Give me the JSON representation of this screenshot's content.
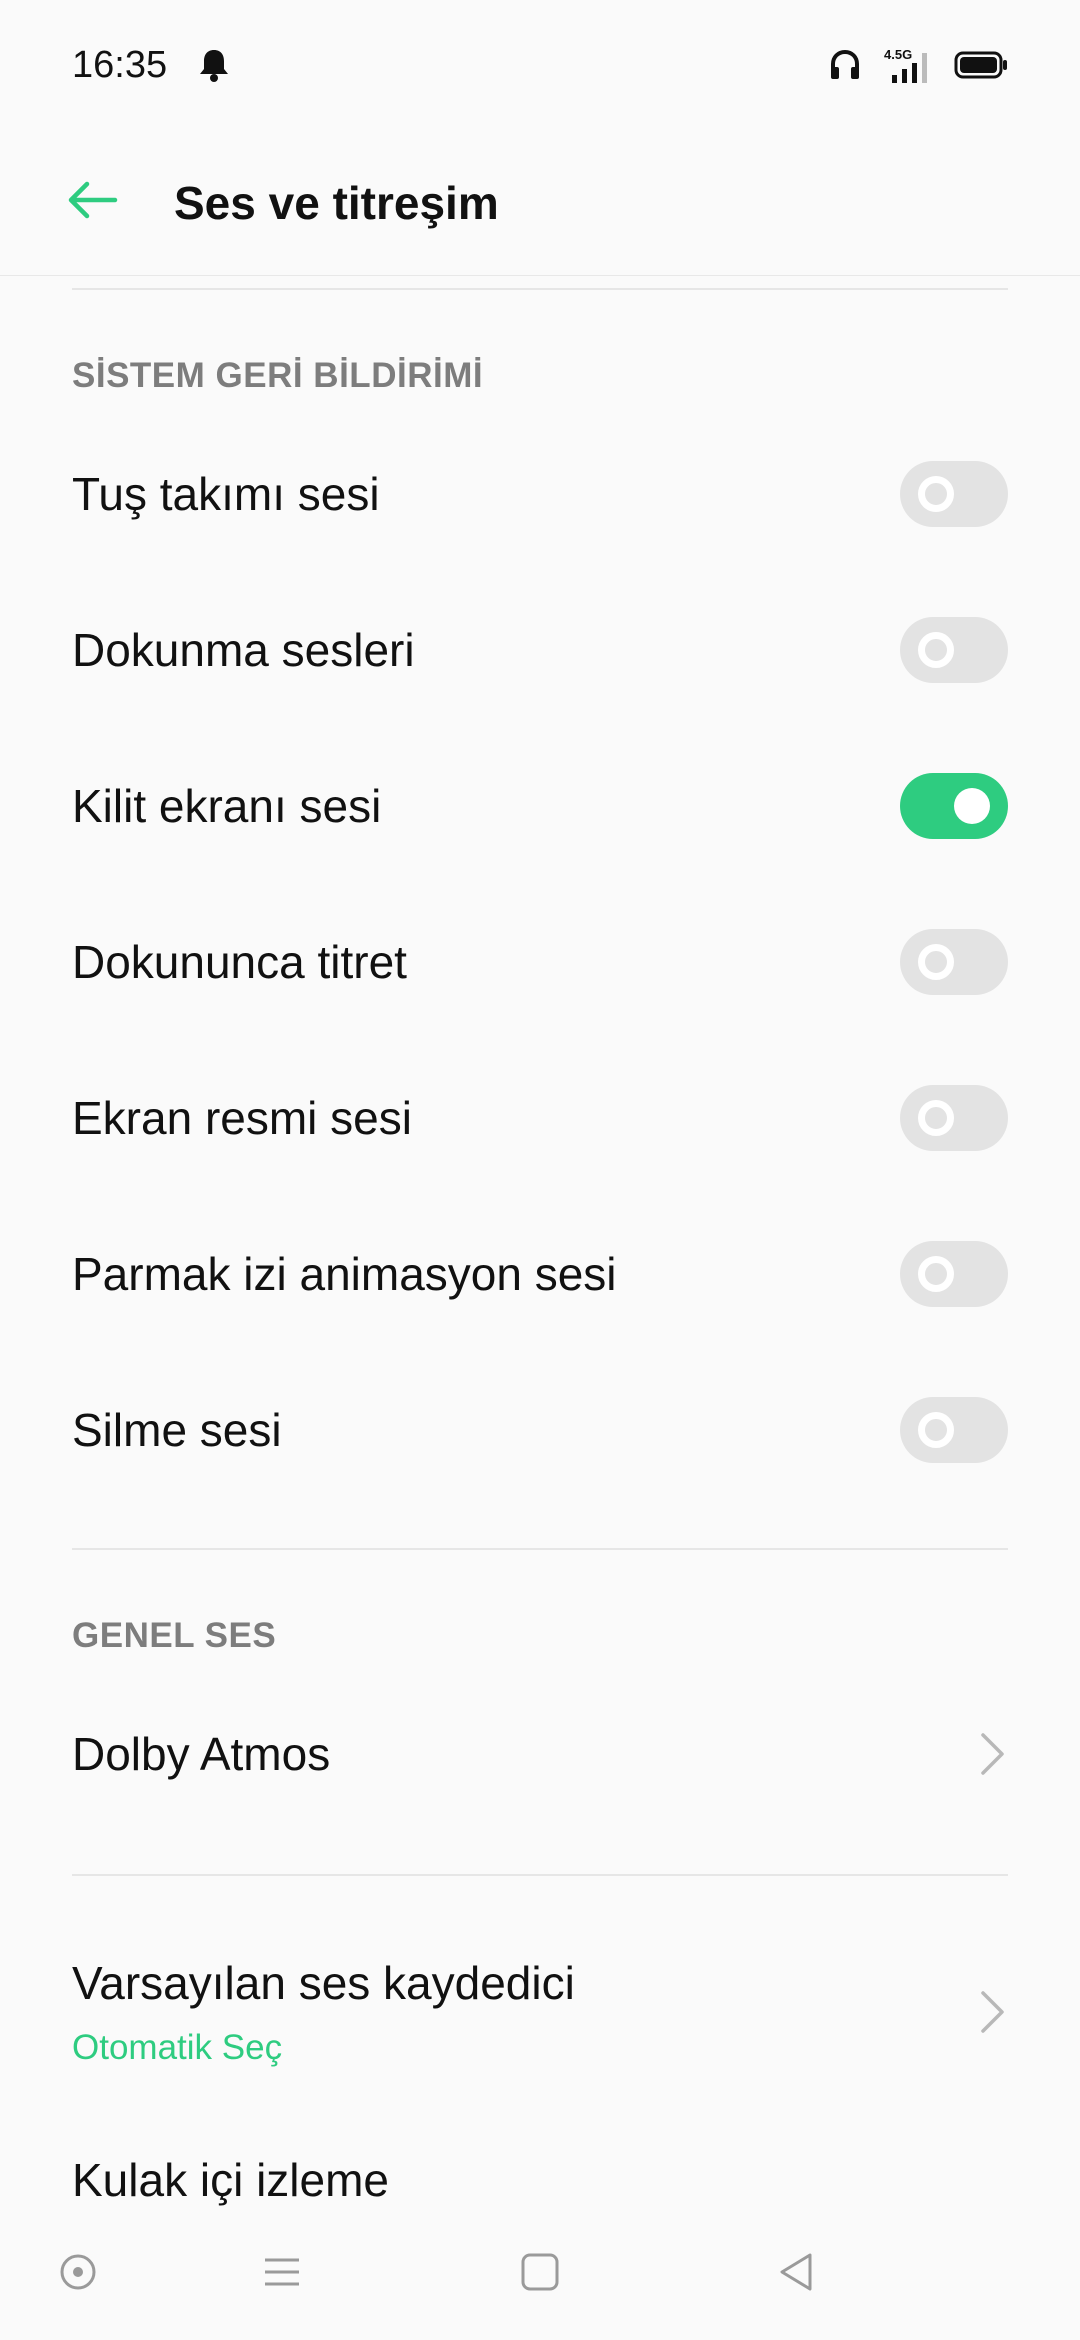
{
  "status_bar": {
    "time": "16:35",
    "network_label": "4.5G",
    "icons": [
      "bell-icon",
      "headset-icon",
      "signal-icon",
      "battery-icon"
    ]
  },
  "header": {
    "title": "Ses ve titreşim",
    "back_icon": "arrow-left-icon"
  },
  "sections": {
    "system_feedback": {
      "header": "SİSTEM GERİ BİLDİRİMİ",
      "items": [
        {
          "label": "Tuş takımı sesi",
          "enabled": false
        },
        {
          "label": "Dokunma sesleri",
          "enabled": false
        },
        {
          "label": "Kilit ekranı sesi",
          "enabled": true
        },
        {
          "label": "Dokununca titret",
          "enabled": false
        },
        {
          "label": "Ekran resmi sesi",
          "enabled": false
        },
        {
          "label": "Parmak izi animasyon sesi",
          "enabled": false
        },
        {
          "label": "Silme sesi",
          "enabled": false
        }
      ]
    },
    "general_sound": {
      "header": "GENEL SES",
      "dolby": {
        "label": "Dolby Atmos"
      }
    },
    "recorder": {
      "label": "Varsayılan ses kaydedici",
      "value": "Otomatik Seç"
    },
    "in_ear": {
      "label": "Kulak içi izleme"
    }
  },
  "nav_bar": {
    "icons": [
      "assistant-icon",
      "menu-icon",
      "home-icon",
      "back-icon"
    ]
  },
  "colors": {
    "accent": "#2ecc80",
    "toggle_off": "#e3e3e3",
    "section_header": "#7d7d7d",
    "background": "#fafafa"
  }
}
